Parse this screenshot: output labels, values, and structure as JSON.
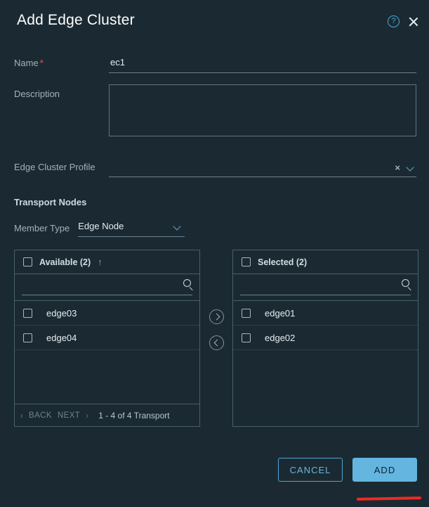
{
  "dialog": {
    "title": "Add Edge Cluster",
    "help_icon": "help-circle-icon",
    "close_icon": "close-icon"
  },
  "form": {
    "name": {
      "label": "Name",
      "required_mark": "*",
      "value": "ec1",
      "placeholder": ""
    },
    "description": {
      "label": "Description",
      "value": "",
      "placeholder": ""
    },
    "edge_cluster_profile": {
      "label": "Edge Cluster Profile",
      "value": "",
      "clear_icon": "×",
      "chevron_icon": "chevron-down-icon"
    }
  },
  "transport_nodes": {
    "section_title": "Transport Nodes",
    "member_type": {
      "label": "Member Type",
      "value": "Edge Node"
    },
    "available": {
      "header": "Available (2)",
      "sort_indicator": "↑",
      "search_value": "",
      "search_placeholder": "",
      "items": [
        {
          "label": "edge03",
          "checked": false
        },
        {
          "label": "edge04",
          "checked": false
        }
      ],
      "pagination": {
        "back": "BACK",
        "next": "NEXT",
        "count": "1 - 4 of 4 Transport"
      }
    },
    "selected": {
      "header": "Selected (2)",
      "search_value": "",
      "search_placeholder": "",
      "items": [
        {
          "label": "edge01",
          "checked": false
        },
        {
          "label": "edge02",
          "checked": false
        }
      ]
    },
    "movers": {
      "move_right": "move-right-button",
      "move_left": "move-left-button"
    }
  },
  "footer": {
    "cancel_label": "CANCEL",
    "add_label": "ADD"
  },
  "colors": {
    "background": "#1b2a32",
    "accent": "#64b5e0",
    "required": "#e8574a",
    "annotation": "#ef2a24",
    "panel_border": "#46606d"
  },
  "annotation": {
    "type": "red-underline",
    "target": "add-button"
  }
}
